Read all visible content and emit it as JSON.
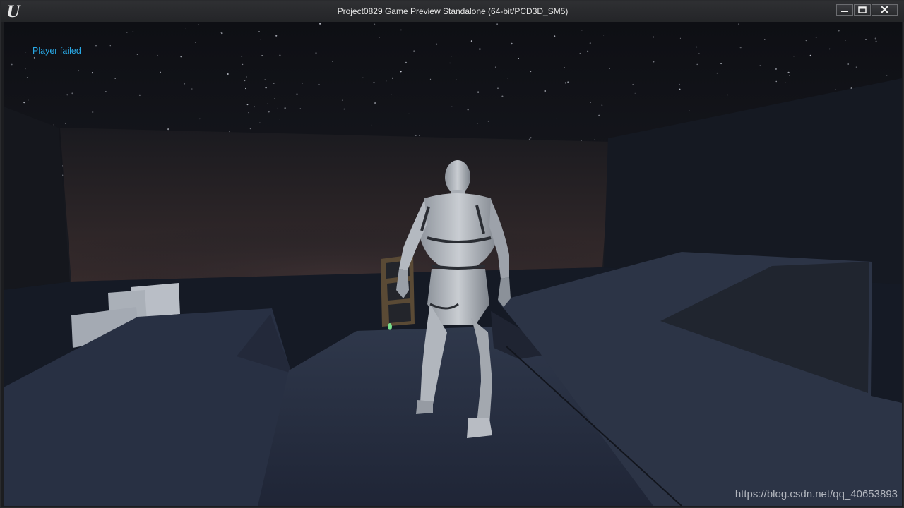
{
  "window": {
    "title": "Project0829 Game Preview Standalone (64-bit/PCD3D_SM5)",
    "logo_icon": "unreal-engine-logo",
    "controls": [
      "minimize-icon",
      "maximize-icon",
      "close-icon"
    ]
  },
  "hud": {
    "message": "Player failed",
    "message_color": "#29a9e6"
  },
  "scene": {
    "sky": "starry-night-sky",
    "character": "white-mannequin-back-view",
    "floor_color": "#2b3447"
  },
  "watermark": {
    "text": "https://blog.csdn.net/qq_40653893"
  }
}
